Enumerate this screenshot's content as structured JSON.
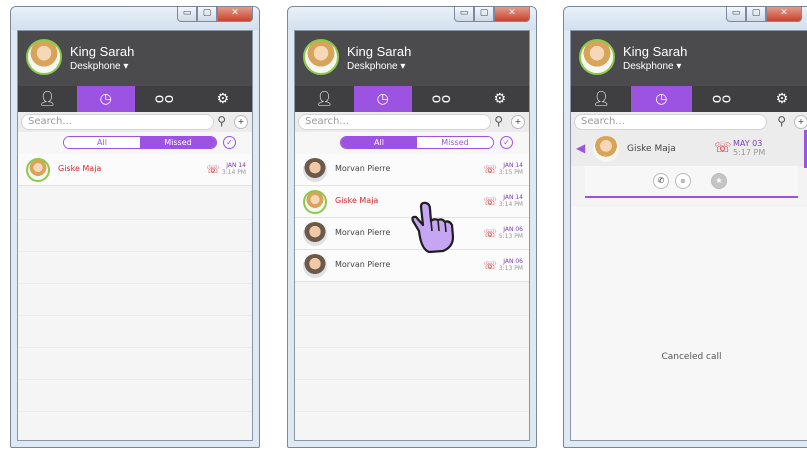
{
  "profile": {
    "name": "King Sarah",
    "device": "Deskphone ▾"
  },
  "window_controls": {
    "min": "▭",
    "max": "▢",
    "close": "✕"
  },
  "search": {
    "placeholder": "Search..."
  },
  "filter": {
    "all": "All",
    "missed": "Missed"
  },
  "panel1": {
    "calls": [
      {
        "name": "Giske Maja",
        "month": "JAN 14",
        "time": "3:14 PM",
        "missed": true
      }
    ]
  },
  "panel2": {
    "calls": [
      {
        "name": "Morvan Pierre",
        "month": "JAN 14",
        "time": "3:15 PM",
        "missed": false
      },
      {
        "name": "Giske Maja",
        "month": "JAN 14",
        "time": "3:14 PM",
        "missed": true
      },
      {
        "name": "Morvan Pierre",
        "month": "JAN 06",
        "time": "5:13 PM",
        "missed": false
      },
      {
        "name": "Morvan Pierre",
        "month": "JAN 06",
        "time": "3:13 PM",
        "missed": false
      }
    ]
  },
  "panel3": {
    "contact": "Giske Maja",
    "month": "MAY 03",
    "time": "5:17 PM",
    "status": "Canceled call"
  },
  "icons": [
    "user-icon",
    "history-icon",
    "voicemail-icon",
    "gear-icon",
    "search-icon",
    "add-contact-icon",
    "missed-call-icon",
    "pointer-hand-icon",
    "back-arrow-icon",
    "trash-icon",
    "phone-icon",
    "chat-icon",
    "star-icon"
  ],
  "accent": "#9d53e2"
}
